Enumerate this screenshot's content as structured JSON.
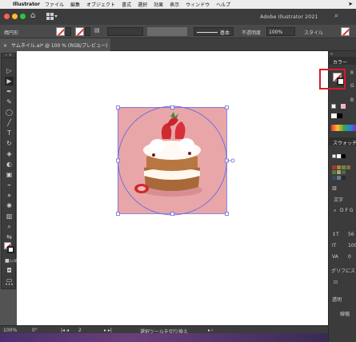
{
  "menubar": {
    "app": "Illustrator",
    "items": [
      "ファイル",
      "編集",
      "オブジェクト",
      "書式",
      "選択",
      "効果",
      "表示",
      "ウィンドウ",
      "ヘルプ"
    ]
  },
  "titlebar": {
    "title": "Adobe Illustrator 2021"
  },
  "controlbar": {
    "shape_label": "楕円形",
    "stroke_style": "基本",
    "opacity_label": "不透明度",
    "opacity_value": "100%",
    "style_label": "スタイル"
  },
  "document": {
    "tab_title": "サムネイル.ai* @ 100 % (RGB/プレビュー)"
  },
  "panels": {
    "color": "カラー",
    "r": "R",
    "g": "G",
    "b": "B",
    "swatches": "スウォッチ",
    "character": "文字",
    "font_preview": "D F G",
    "size1": "56",
    "size2": "100",
    "size3": "0",
    "glyph": "グリフにス",
    "transparency": "透明",
    "appearance": "線幅"
  },
  "statusbar": {
    "zoom": "100%",
    "rotate": "0°",
    "artboard": "2",
    "tool_hint": "選択ツールを切り換え"
  },
  "colors": {
    "accent": "#d91a2a",
    "selection": "#6b6bdc",
    "art_bg": "#e8a6a9"
  }
}
